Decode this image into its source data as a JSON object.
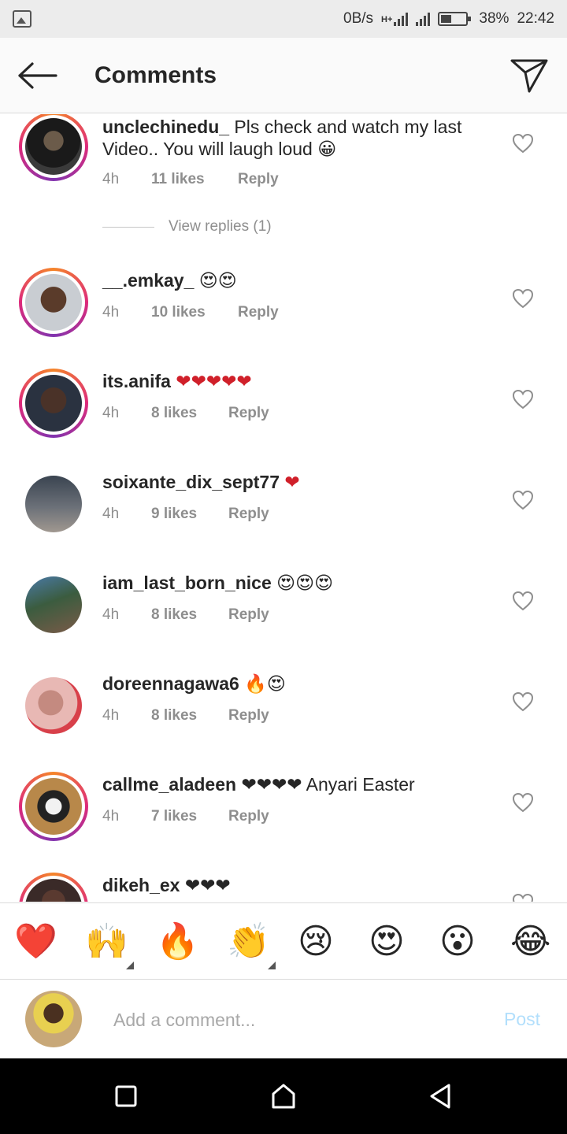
{
  "status_bar": {
    "speed": "0B/s",
    "network": "H+",
    "battery": "38%",
    "time": "22:42",
    "icons": [
      "gallery-icon",
      "signal-icon",
      "battery-icon"
    ]
  },
  "header": {
    "title": "Comments",
    "back_icon": "arrow-left-icon",
    "send_icon": "paper-plane-icon"
  },
  "comments": [
    {
      "username": "unclechinedu_",
      "text": " Pls check and watch my last Video.. You will laugh loud 😀",
      "time": "4h",
      "likes": "11 likes",
      "reply": "Reply",
      "story_ring": true,
      "view_replies": "View replies (1)"
    },
    {
      "username": "__.emkay_",
      "text": " 😍😍",
      "time": "4h",
      "likes": "10 likes",
      "reply": "Reply",
      "story_ring": true
    },
    {
      "username": "its.anifa",
      "text": " ❤❤❤❤❤",
      "time": "4h",
      "likes": "8 likes",
      "reply": "Reply",
      "story_ring": true
    },
    {
      "username": "soixante_dix_sept77",
      "text": " ❤",
      "time": "4h",
      "likes": "9 likes",
      "reply": "Reply",
      "story_ring": false
    },
    {
      "username": "iam_last_born_nice",
      "text": " 😍😍😍",
      "time": "4h",
      "likes": "8 likes",
      "reply": "Reply",
      "story_ring": false
    },
    {
      "username": "doreennagawa6",
      "text": " 🔥😍",
      "time": "4h",
      "likes": "8 likes",
      "reply": "Reply",
      "story_ring": false
    },
    {
      "username": "callme_aladeen",
      "text": " ❤❤❤❤ Anyari Easter",
      "time": "4h",
      "likes": "7 likes",
      "reply": "Reply",
      "story_ring": true
    },
    {
      "username": "dikeh_ex",
      "text": " ❤❤❤",
      "time": "",
      "likes": "",
      "reply": "",
      "story_ring": true
    }
  ],
  "reactions": [
    "❤️",
    "🙌",
    "🔥",
    "👏",
    "😢",
    "😍",
    "😮",
    "😂"
  ],
  "composer": {
    "placeholder": "Add a comment...",
    "post_label": "Post"
  },
  "nav": {
    "icons": [
      "recents-square-icon",
      "home-icon",
      "back-triangle-icon"
    ]
  },
  "colors": {
    "accent_blue_disabled": "#b2dffc",
    "meta_gray": "#8e8e8e",
    "story_ring": "#dd2a7b"
  }
}
